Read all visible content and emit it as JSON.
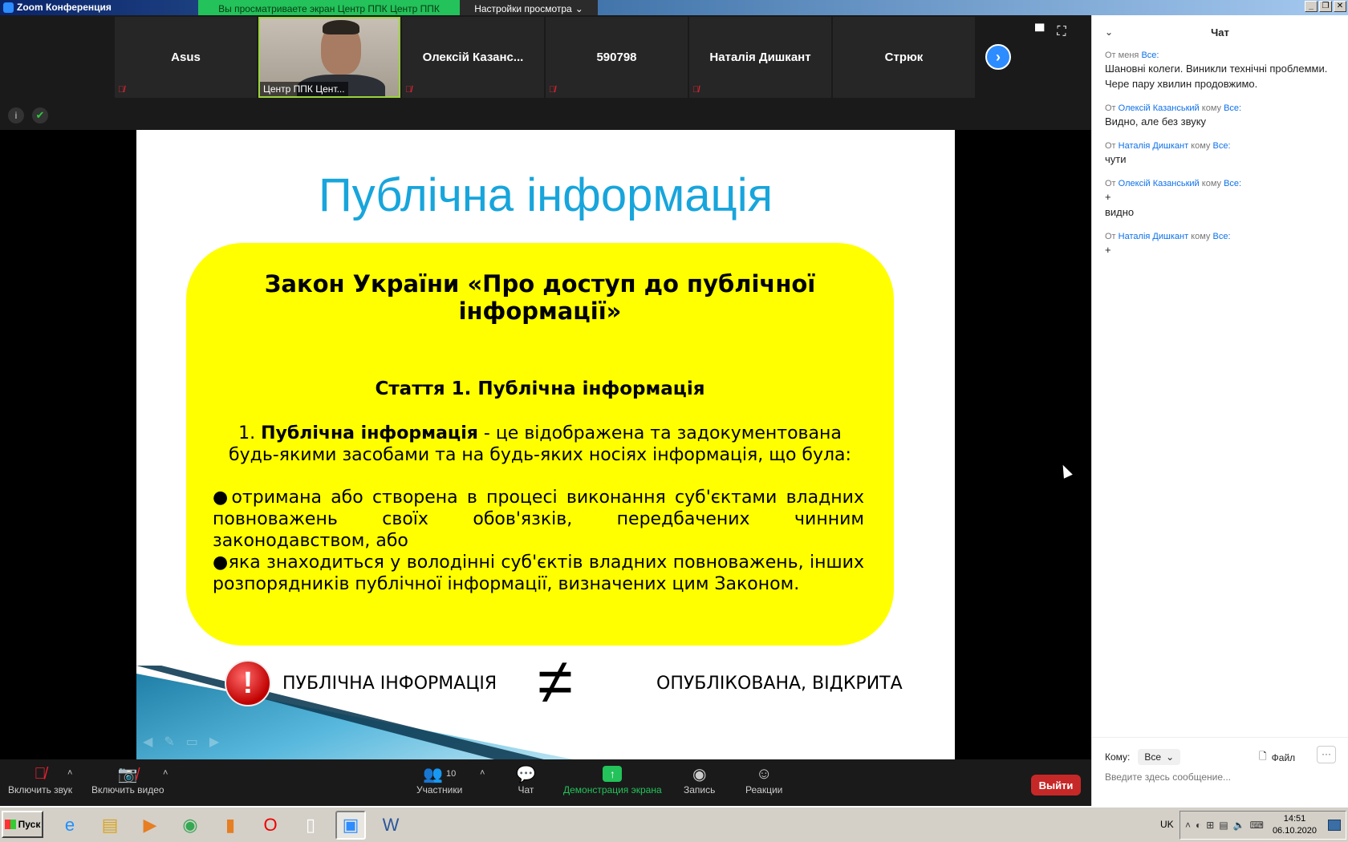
{
  "window": {
    "title": "Zoom Конференция",
    "share_banner": "Вы просматриваете экран Центр ППК Центр ППК",
    "view_options": "Настройки просмотра",
    "controls": [
      "_",
      "❐",
      "✕"
    ]
  },
  "participants": [
    {
      "name": "Asus",
      "muted": true,
      "video": false
    },
    {
      "name": "Центр ППК Цент...",
      "muted": false,
      "video": true
    },
    {
      "name": "Олексій  Казанс...",
      "muted": true,
      "video": false
    },
    {
      "name": "590798",
      "muted": true,
      "video": false
    },
    {
      "name": "Наталія Дишкант",
      "muted": true,
      "video": false
    },
    {
      "name": "Стрюк",
      "muted": false,
      "video": false
    }
  ],
  "slide": {
    "title": "Публічна інформація",
    "law_title": "Закон України «Про доступ до публічної інформації»",
    "article_title": "Стаття 1. Публічна інформація",
    "definition_prefix": "1. ",
    "definition_term": "Публічна інформація",
    "definition_rest": " - це відображена та задокументована будь-якими засобами та на будь-яких носіях інформація, що була:",
    "bullet_1": "●отримана або створена в процесі виконання суб'єктами владних повноважень своїх обов'язків, передбачених чинним законодавством, або",
    "bullet_2": "●яка знаходиться у володінні суб'єктів владних повноважень, інших розпорядників публічної інформації, визначених цим Законом.",
    "left_label": "ПУБЛІЧНА ІНФОРМАЦІЯ",
    "neq": "≠",
    "right_label": "ОПУБЛІКОВАНА, ВІДКРИТА"
  },
  "toolbar": {
    "audio": "Включить звук",
    "video": "Включить видео",
    "participants": "Участники",
    "participants_count": "10",
    "chat": "Чат",
    "share": "Демонстрация экрана",
    "record": "Запись",
    "reactions": "Реакции",
    "leave": "Выйти"
  },
  "chat": {
    "title": "Чат",
    "messages": [
      {
        "from_prefix": "От меня",
        "from": "",
        "to_prefix": "",
        "to": "Все:",
        "text": "Шановні колеги. Виникли технічні проблемми. Чере пару хвилин продовжимо."
      },
      {
        "from_prefix": "От",
        "from": "Олексій Казанський",
        "to_prefix": "кому",
        "to": "Все:",
        "text": "Видно, але без звуку"
      },
      {
        "from_prefix": "От",
        "from": "Наталія Дишкант",
        "to_prefix": "кому",
        "to": "Все:",
        "text": "чути"
      },
      {
        "from_prefix": "От",
        "from": "Олексій Казанський",
        "to_prefix": "кому",
        "to": "Все:",
        "text": "+\nвидно"
      },
      {
        "from_prefix": "От",
        "from": "Наталія Дишкант",
        "to_prefix": "кому",
        "to": "Все:",
        "text": "+"
      }
    ],
    "to_label": "Кому:",
    "to_value": "Все",
    "file_label": "Файл",
    "more": "···",
    "input_placeholder": "Введите здесь сообщение..."
  },
  "taskbar": {
    "start": "Пуск",
    "lang": "UK",
    "time": "14:51",
    "date": "06.10.2020"
  },
  "colors": {
    "zoom_blue": "#2d8cff",
    "share_green": "#23c25a",
    "slide_title": "#17a5dc",
    "slide_box": "#ffff00",
    "leave_red": "#c62828"
  }
}
